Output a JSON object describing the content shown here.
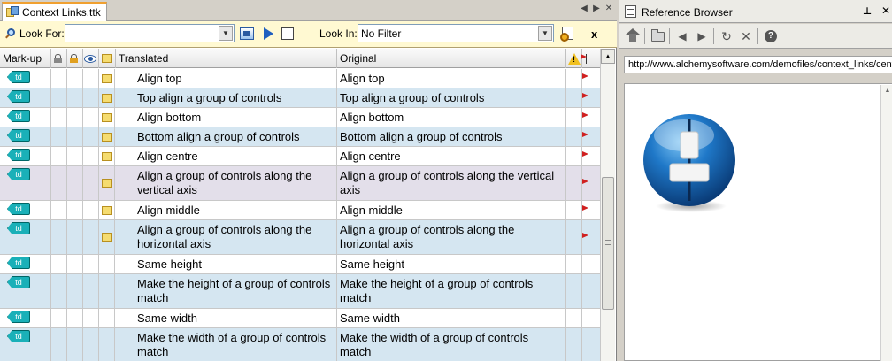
{
  "document_tab": {
    "title": "Context Links.ttk"
  },
  "search_bar": {
    "look_for_label": "Look For:",
    "look_for_value": "",
    "look_in_label": "Look In:",
    "look_in_value": "No Filter",
    "close_label": "x"
  },
  "grid": {
    "columns": {
      "markup": "Mark-up",
      "translated": "Translated",
      "original": "Original"
    },
    "rows": [
      {
        "tag": "td",
        "translated": "Align top",
        "original": "Align top",
        "note": true,
        "flag": true,
        "lines": 1,
        "shade": "white"
      },
      {
        "tag": "td",
        "translated": "Top align a group of controls",
        "original": "Top align a group of controls",
        "note": true,
        "flag": true,
        "lines": 1,
        "shade": "blue"
      },
      {
        "tag": "td",
        "translated": "Align bottom",
        "original": "Align bottom",
        "note": true,
        "flag": true,
        "lines": 1,
        "shade": "white"
      },
      {
        "tag": "td",
        "translated": "Bottom align a group of controls",
        "original": "Bottom align a group of controls",
        "note": true,
        "flag": true,
        "lines": 1,
        "shade": "blue"
      },
      {
        "tag": "td",
        "translated": "Align centre",
        "original": "Align centre",
        "note": true,
        "flag": true,
        "lines": 1,
        "shade": "white"
      },
      {
        "tag": "td",
        "translated": "Align a group of controls along the vertical axis",
        "original": "Align a group of controls along the vertical axis",
        "note": true,
        "flag": true,
        "lines": 2,
        "shade": "lav"
      },
      {
        "tag": "td",
        "translated": "Align middle",
        "original": "Align middle",
        "note": true,
        "flag": true,
        "lines": 1,
        "shade": "white"
      },
      {
        "tag": "td",
        "translated": "Align a group of controls along the horizontal axis",
        "original": "Align a group of controls along the horizontal axis",
        "note": true,
        "flag": true,
        "lines": 2,
        "shade": "blue"
      },
      {
        "tag": "td",
        "translated": "Same height",
        "original": "Same height",
        "note": false,
        "flag": false,
        "lines": 1,
        "shade": "white"
      },
      {
        "tag": "td",
        "translated": "Make the height of a group of controls match",
        "original": "Make the height of a group of controls match",
        "note": false,
        "flag": false,
        "lines": 2,
        "shade": "blue"
      },
      {
        "tag": "td",
        "translated": "Same width",
        "original": "Same width",
        "note": false,
        "flag": false,
        "lines": 1,
        "shade": "white"
      },
      {
        "tag": "td",
        "translated": "Make the width of a group of controls match",
        "original": "Make the width of a group of controls match",
        "note": false,
        "flag": false,
        "lines": 2,
        "shade": "blue"
      }
    ]
  },
  "reference_browser": {
    "title": "Reference Browser",
    "url": "http://www.alchemysoftware.com/demofiles/context_links/center.html"
  },
  "colors": {
    "accent_tab": "#f0a030",
    "row_blue": "#d5e6f1",
    "row_lavender": "#e3dfea",
    "td_tag": "#1ab0b8",
    "flag_red": "#d02020"
  },
  "icons": {
    "tab": "ttk-file-icon",
    "look_for": "magnifier-icon",
    "binoculars": "find-icon",
    "next": "play-icon",
    "toggle": "checkbox-icon",
    "filter": "filter-settings-icon",
    "home": "home-icon",
    "open": "folder-icon",
    "back": "back-arrow-icon",
    "forward": "forward-arrow-icon",
    "refresh": "refresh-icon",
    "stop": "stop-icon",
    "help": "help-icon"
  }
}
